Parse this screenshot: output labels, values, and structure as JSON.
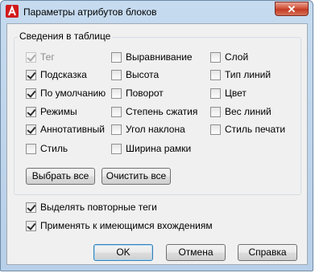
{
  "window": {
    "title": "Параметры атрибутов блоков",
    "close_glyph": "✕",
    "app_icon": "autocad-a-icon"
  },
  "group": {
    "title": "Сведения в таблице",
    "col1": [
      {
        "label": "Тег",
        "checked": true,
        "disabled": true
      },
      {
        "label": "Подсказка",
        "checked": true
      },
      {
        "label": "По умолчанию",
        "checked": true
      },
      {
        "label": "Режимы",
        "checked": true
      },
      {
        "label": "Аннотативный",
        "checked": true
      },
      {
        "label": "Стиль",
        "checked": false
      }
    ],
    "col2": [
      {
        "label": "Выравнивание",
        "checked": false
      },
      {
        "label": "Высота",
        "checked": false
      },
      {
        "label": "Поворот",
        "checked": false
      },
      {
        "label": "Степень сжатия",
        "checked": false
      },
      {
        "label": "Угол наклона",
        "checked": false
      },
      {
        "label": "Ширина рамки",
        "checked": false
      }
    ],
    "col3": [
      {
        "label": "Слой",
        "checked": false
      },
      {
        "label": "Тип линий",
        "checked": false
      },
      {
        "label": "Цвет",
        "checked": false
      },
      {
        "label": "Вес линий",
        "checked": false
      },
      {
        "label": "Стиль печати",
        "checked": false
      }
    ],
    "select_all": "Выбрать все",
    "clear_all": "Очистить все"
  },
  "options": [
    {
      "label": "Выделять повторные теги",
      "checked": true
    },
    {
      "label": "Применять к имеющимся вхождениям",
      "checked": true
    }
  ],
  "buttons": {
    "ok": "OK",
    "cancel": "Отмена",
    "help": "Справка"
  }
}
